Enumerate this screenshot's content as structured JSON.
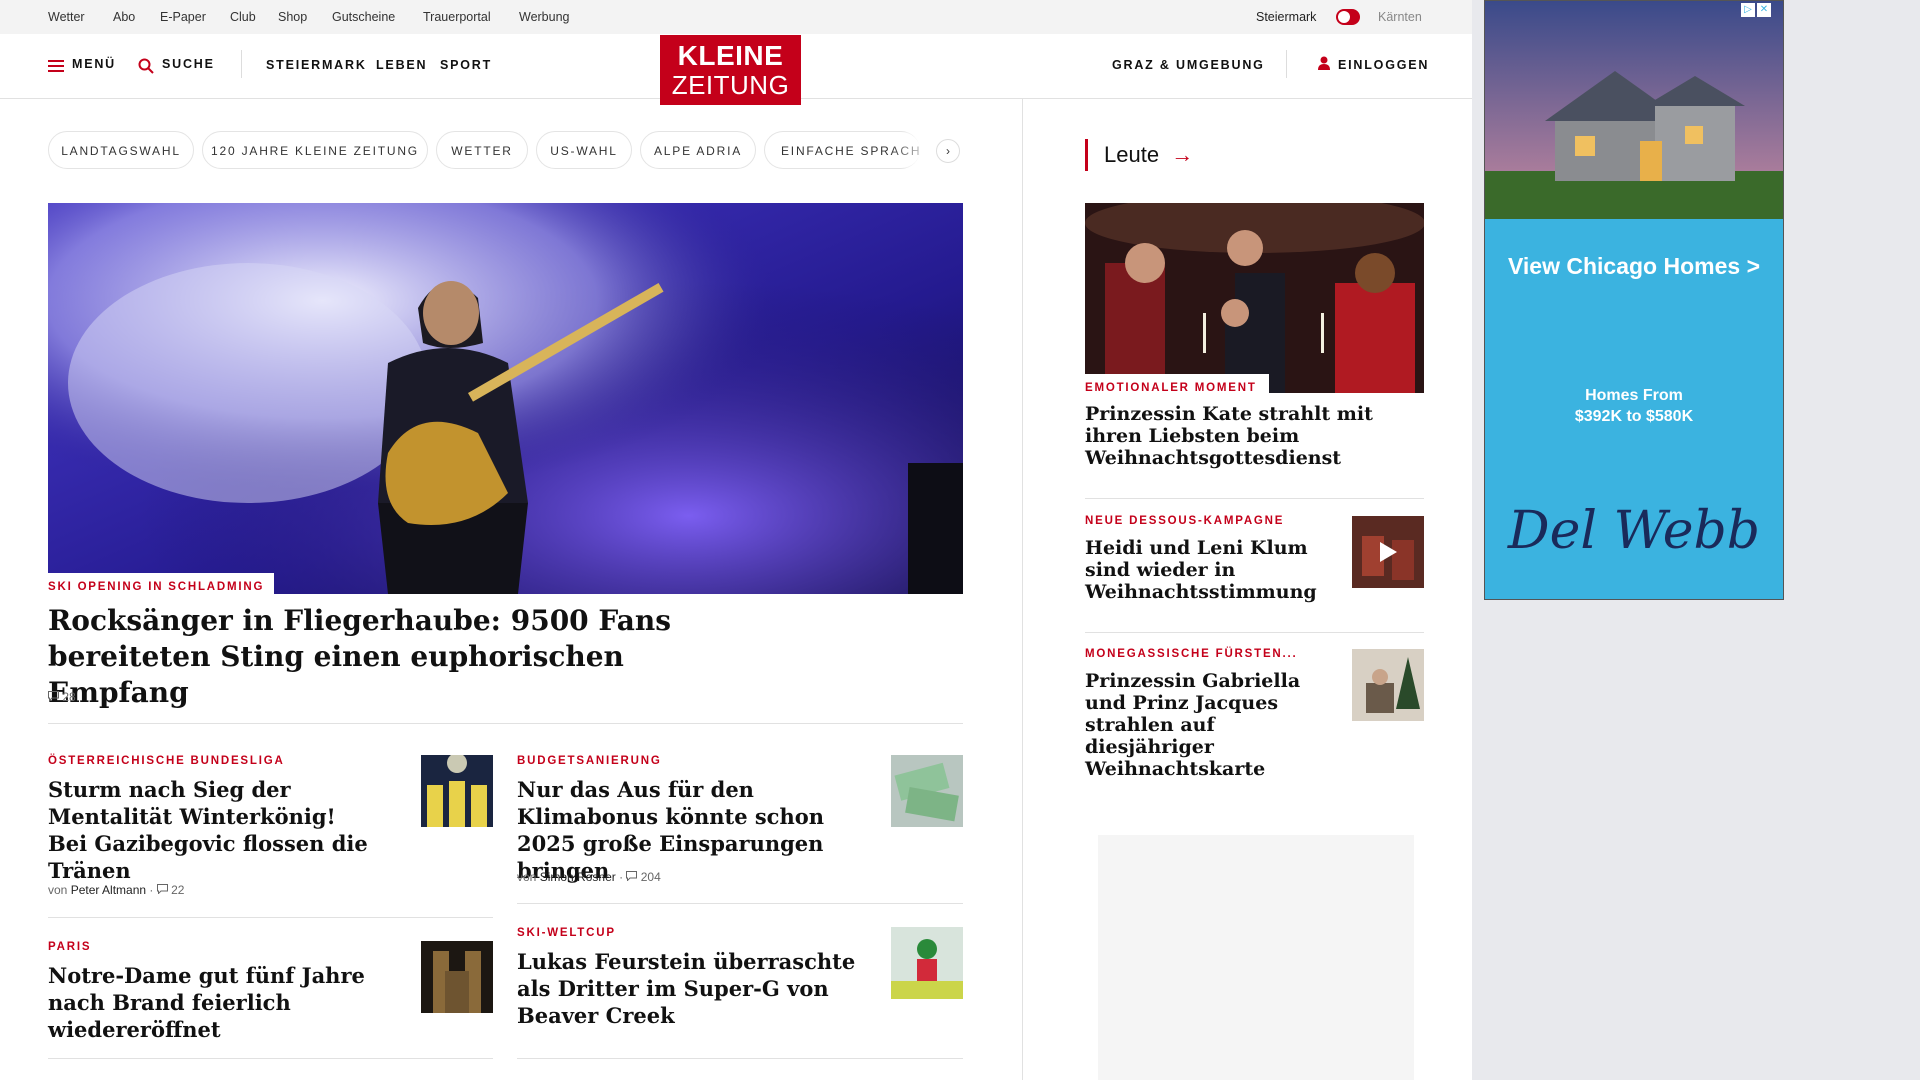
{
  "utility_nav": {
    "links": [
      "Wetter",
      "Abo",
      "E-Paper",
      "Club",
      "Shop",
      "Gutscheine",
      "Trauerportal",
      "Werbung"
    ],
    "region_active": "Steiermark",
    "region_alt": "Kärnten"
  },
  "header": {
    "menu_label": "MENÜ",
    "search_label": "SUCHE",
    "sections": [
      "STEIERMARK",
      "LEBEN",
      "SPORT"
    ],
    "logo_line1": "KLEINE",
    "logo_line2": "ZEITUNG",
    "region_label": "GRAZ & UMGEBUNG",
    "login_label": "EINLOGGEN"
  },
  "topic_chips": [
    "LANDTAGSWAHL",
    "120 JAHRE KLEINE ZEITUNG",
    "WETTER",
    "US-WAHL",
    "ALPE ADRIA",
    "EINFACHE SPRACHE"
  ],
  "hero": {
    "kicker": "SKI OPENING IN SCHLADMING",
    "headline": "Rocksänger in Fliegerhaube: 9500 Fans bereiteten Sting einen euphorischen Empfang",
    "comments": "28"
  },
  "articles": [
    {
      "kicker": "ÖSTERREICHISCHE BUNDESLIGA",
      "headline": "Sturm nach Sieg der Mentalität Winterkönig! Bei Gazibegovic flossen die Tränen",
      "by": "von",
      "author": "Peter Altmann",
      "comments": "22"
    },
    {
      "kicker": "BUDGETSANIERUNG",
      "headline": "Nur das Aus für den Klimabonus könnte schon 2025 große Einsparungen bringen",
      "by": "von",
      "author": "Simon Rosner",
      "comments": "204"
    },
    {
      "kicker": "PARIS",
      "headline": "Notre-Dame gut fünf Jahre nach Brand feierlich wiedereröffnet"
    },
    {
      "kicker": "SKI-WELTCUP",
      "headline": "Lukas Feurstein überraschte als Dritter im Super-G von Beaver Creek"
    }
  ],
  "sidebar": {
    "section_title": "Leute",
    "arrow": "→",
    "lead": {
      "kicker": "EMOTIONALER MOMENT",
      "headline": "Prinzessin Kate strahlt mit ihren Liebsten beim Weihnachtsgottesdienst"
    },
    "items": [
      {
        "kicker": "NEUE DESSOUS-KAMPAGNE",
        "headline": "Heidi und Leni Klum sind wieder in Weihnachtsstimmung"
      },
      {
        "kicker": "MONEGASSISCHE FÜRSTEN...",
        "headline": "Prinzessin Gabriella und Prinz Jacques strahlen auf diesjähriger Weihnachtskarte"
      }
    ]
  },
  "ad": {
    "cta": "View Chicago Homes >",
    "price_line1": "Homes From",
    "price_line2": "$392K to $580K",
    "brand": "Del Webb"
  },
  "colors": {
    "brand_red": "#c4001a",
    "ad_blue": "#3bb3e0",
    "ad_brand_navy": "#1a2a5a"
  }
}
